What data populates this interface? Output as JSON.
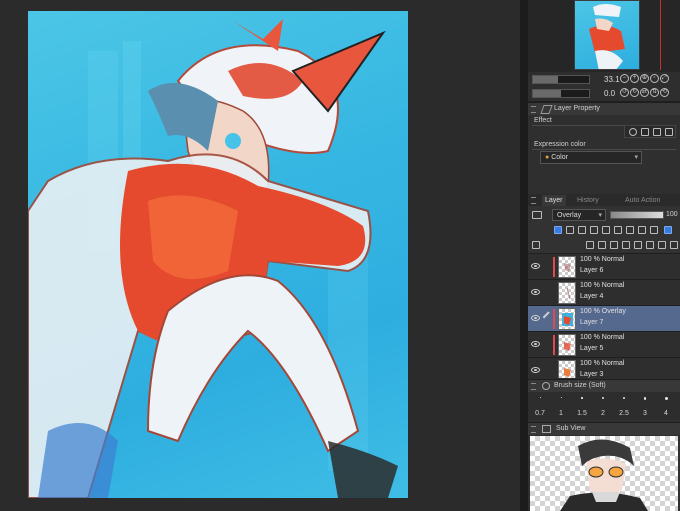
{
  "panels": {
    "navigator": {
      "zoom_value": "33.1",
      "rotation_value": "0.0"
    },
    "layer_property": {
      "title": "Layer Property",
      "effect_label": "Effect",
      "expression_color_label": "Expression color",
      "expression_color_value": "Color"
    },
    "layer": {
      "tabs": [
        "Layer",
        "History",
        "Auto Action"
      ],
      "blend_mode": "Overlay",
      "opacity_value": "100",
      "layers": [
        {
          "mode": "100 % Normal",
          "name": "Layer 6",
          "selected": false
        },
        {
          "mode": "100 % Normal",
          "name": "Layer 4",
          "selected": false
        },
        {
          "mode": "100 % Overlay",
          "name": "Layer 7",
          "selected": true
        },
        {
          "mode": "100 % Normal",
          "name": "Layer 5",
          "selected": false
        },
        {
          "mode": "100 % Normal",
          "name": "Layer 3",
          "selected": false
        }
      ]
    },
    "brush_size": {
      "title": "Brush size (Soft)",
      "sizes": [
        "0.7",
        "1",
        "1.5",
        "2",
        "2.5",
        "3",
        "4"
      ]
    },
    "sub_view": {
      "title": "Sub View"
    }
  },
  "colors": {
    "canvas_bg": "#2b2b2b",
    "artwork_cyan": "#36b7e2",
    "accent_red": "#e04a4a",
    "selected_layer": "#55688e"
  }
}
